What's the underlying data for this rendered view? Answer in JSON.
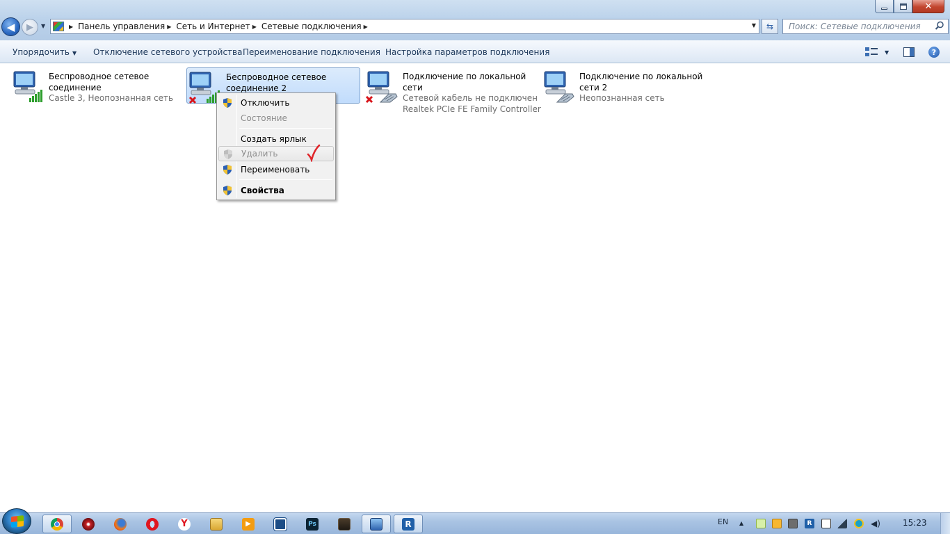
{
  "window": {
    "buttons": {
      "minimize": "minimize",
      "maximize": "restore",
      "close": "close"
    }
  },
  "address": {
    "crumbs": [
      "Панель управления",
      "Сеть и Интернет",
      "Сетевые подключения"
    ],
    "search_placeholder": "Поиск: Сетевые подключения"
  },
  "toolbar": {
    "organize": "Упорядочить",
    "disable_device": "Отключение сетевого устройства",
    "rename_connection": "Переименование подключения",
    "connection_settings": "Настройка параметров подключения"
  },
  "connections": [
    {
      "name": "Беспроводное сетевое соединение",
      "status": "Castle  3, Неопознанная сеть",
      "type": "wireless",
      "disabled": false,
      "selected": false
    },
    {
      "name": "Беспроводное сетевое соединение 2",
      "status": "",
      "type": "wireless",
      "disabled": true,
      "selected": true
    },
    {
      "name": "Подключение по локальной сети",
      "status": "Сетевой кабель не подключен",
      "status2": "Realtek PCIe FE Family Controller",
      "type": "ethernet",
      "disabled": true,
      "selected": false
    },
    {
      "name": "Подключение по локальной сети 2",
      "status": "Неопознанная сеть",
      "type": "ethernet",
      "disabled": false,
      "selected": false
    }
  ],
  "context_menu": {
    "items": [
      {
        "label": "Отключить",
        "shield": true,
        "disabled": false
      },
      {
        "label": "Состояние",
        "shield": false,
        "disabled": true
      },
      {
        "label": "Создать ярлык",
        "shield": false,
        "disabled": false
      },
      {
        "label": "Удалить",
        "shield": true,
        "disabled": true,
        "hovered": true
      },
      {
        "label": "Переименовать",
        "shield": true,
        "disabled": false
      },
      {
        "label": "Свойства",
        "shield": true,
        "disabled": false,
        "bold": true
      }
    ],
    "annotation": "red-checkmark"
  },
  "taskbar": {
    "apps": [
      "chrome-icon",
      "media-player-icon",
      "firefox-icon",
      "opera-icon",
      "yandex-browser-icon",
      "file-explorer-icon",
      "video-player-icon",
      "ipod-app-icon",
      "photoshop-icon",
      "terminal-icon",
      "network-connections-icon",
      "r-app-icon"
    ],
    "language": "EN",
    "clock": "15:23",
    "tray_icons": [
      "notes-icon",
      "security-icon",
      "settings-icon",
      "r-tray-icon",
      "usb-device-icon",
      "signal-icon",
      "sync-icon",
      "volume-icon"
    ]
  },
  "colors": {
    "accent": "#2a68c1",
    "selection": "#c1dcfc",
    "disabled_x": "#d8141a",
    "signal_green": "#2e9e2e",
    "checkmark": "#e0262b"
  }
}
